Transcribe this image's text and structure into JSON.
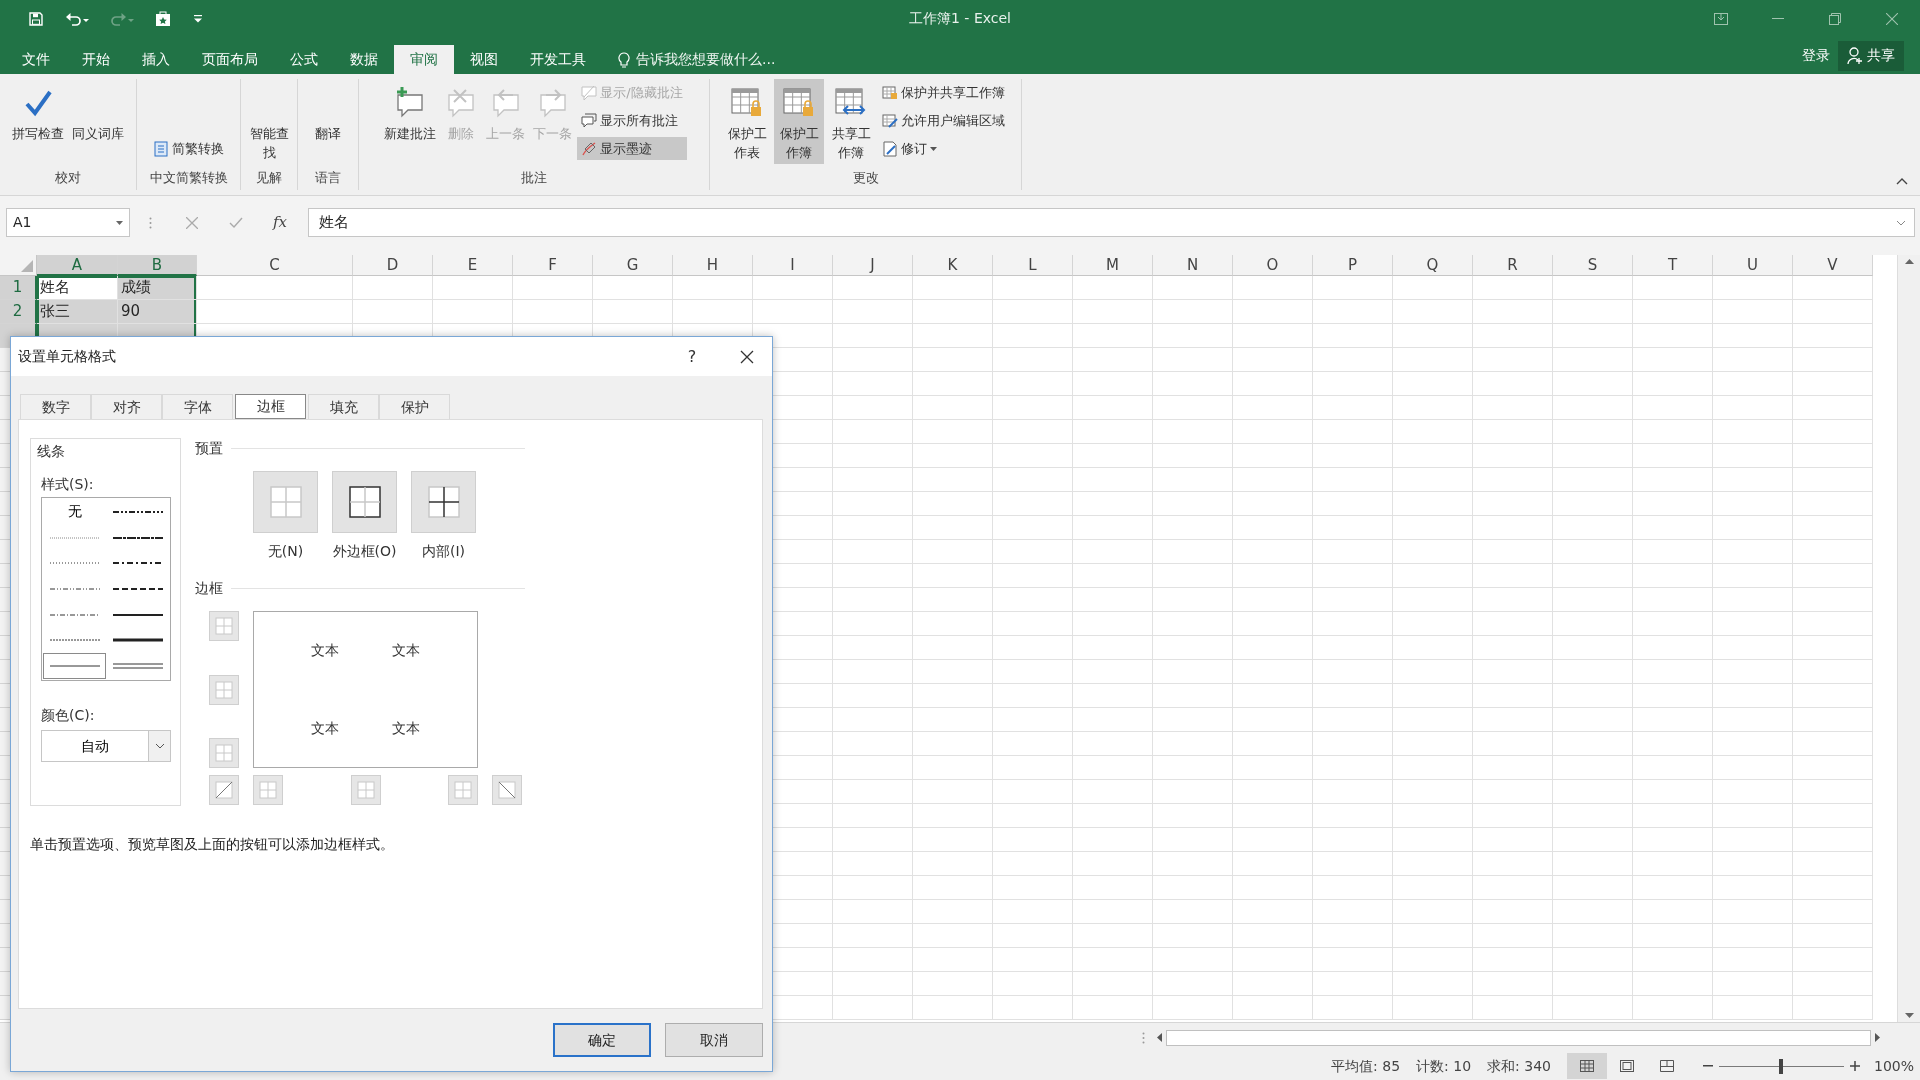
{
  "title_bar": {
    "title": "工作簿1 - Excel"
  },
  "quick_access": [
    {
      "kind": "save",
      "disabled": false
    },
    {
      "kind": "undo",
      "disabled": false
    },
    {
      "kind": "redo",
      "disabled": true
    },
    {
      "kind": "touch",
      "disabled": false
    },
    {
      "kind": "customize",
      "disabled": false
    }
  ],
  "menu_tabs": [
    {
      "label": "文件",
      "selected": false
    },
    {
      "label": "开始",
      "selected": false
    },
    {
      "label": "插入",
      "selected": false
    },
    {
      "label": "页面布局",
      "selected": false
    },
    {
      "label": "公式",
      "selected": false
    },
    {
      "label": "数据",
      "selected": false
    },
    {
      "label": "审阅",
      "selected": true
    },
    {
      "label": "视图",
      "selected": false
    },
    {
      "label": "开发工具",
      "selected": false
    }
  ],
  "tell_me": {
    "placeholder": "告诉我您想要做什么..."
  },
  "account": {
    "sign_in": "登录",
    "share": "共享"
  },
  "ribbon_groups": [
    {
      "label": "校对",
      "items": [
        {
          "kind": "large",
          "label": "拼写检查",
          "disabled": false,
          "selected": false,
          "dropdown": false
        },
        {
          "kind": "large",
          "label": "同义词库",
          "disabled": false,
          "selected": false,
          "dropdown": false
        }
      ]
    },
    {
      "label": "中文简繁转换",
      "items": [
        {
          "kind": "small",
          "label": "简繁转换",
          "disabled": false,
          "selected": false,
          "dropdown": false
        }
      ]
    },
    {
      "label": "见解",
      "items": [
        {
          "kind": "stacked",
          "label": "智能查找",
          "disabled": false,
          "selected": false,
          "dropdown": false
        }
      ]
    },
    {
      "label": "语言",
      "items": [
        {
          "kind": "large",
          "label": "翻译",
          "disabled": false,
          "selected": false,
          "dropdown": false
        }
      ]
    },
    {
      "label": "批注",
      "items": [
        {
          "kind": "large",
          "label": "新建批注",
          "disabled": false,
          "selected": false,
          "dropdown": false
        },
        {
          "kind": "large",
          "label": "删除",
          "disabled": true,
          "selected": false,
          "dropdown": false
        },
        {
          "kind": "large",
          "label": "上一条",
          "disabled": true,
          "selected": false,
          "dropdown": false
        },
        {
          "kind": "large",
          "label": "下一条",
          "disabled": true,
          "selected": false,
          "dropdown": false
        },
        {
          "kind": "small",
          "label": "显示/隐藏批注",
          "disabled": true,
          "selected": false,
          "dropdown": false
        },
        {
          "kind": "small",
          "label": "显示所有批注",
          "disabled": false,
          "selected": false,
          "dropdown": false
        },
        {
          "kind": "small",
          "label": "显示墨迹",
          "disabled": false,
          "selected": true,
          "dropdown": false
        }
      ]
    },
    {
      "label": "更改",
      "items": [
        {
          "kind": "stacked",
          "label": "保护工作表",
          "disabled": false,
          "selected": false,
          "dropdown": false
        },
        {
          "kind": "stacked",
          "label": "保护工作簿",
          "disabled": false,
          "selected": true,
          "dropdown": false
        },
        {
          "kind": "stacked",
          "label": "共享工作簿",
          "disabled": false,
          "selected": false,
          "dropdown": false
        },
        {
          "kind": "small",
          "label": "保护并共享工作簿",
          "disabled": false,
          "selected": false,
          "dropdown": false
        },
        {
          "kind": "small",
          "label": "允许用户编辑区域",
          "disabled": false,
          "selected": false,
          "dropdown": false
        },
        {
          "kind": "small",
          "label": "修订",
          "disabled": false,
          "selected": false,
          "dropdown": true
        }
      ]
    }
  ],
  "formula_bar": {
    "name_box": "A1",
    "fx": "fx",
    "formula": "姓名"
  },
  "sheet": {
    "columns": [
      {
        "label": "A",
        "selected": true
      },
      {
        "label": "B",
        "selected": true
      },
      {
        "label": "C",
        "selected": false
      },
      {
        "label": "D",
        "selected": false
      },
      {
        "label": "E",
        "selected": false
      },
      {
        "label": "F",
        "selected": false
      },
      {
        "label": "G",
        "selected": false
      },
      {
        "label": "H",
        "selected": false
      },
      {
        "label": "I",
        "selected": false
      },
      {
        "label": "J",
        "selected": false
      },
      {
        "label": "K",
        "selected": false
      },
      {
        "label": "L",
        "selected": false
      },
      {
        "label": "M",
        "selected": false
      },
      {
        "label": "N",
        "selected": false
      },
      {
        "label": "O",
        "selected": false
      },
      {
        "label": "P",
        "selected": false
      },
      {
        "label": "Q",
        "selected": false
      },
      {
        "label": "R",
        "selected": false
      },
      {
        "label": "S",
        "selected": false
      },
      {
        "label": "T",
        "selected": false
      },
      {
        "label": "U",
        "selected": false
      },
      {
        "label": "V",
        "selected": false
      }
    ],
    "rows": [
      {
        "header": "1",
        "selected": true,
        "cells": [
          {
            "text": "姓名",
            "selected": true,
            "active": true
          },
          {
            "text": "成绩",
            "selected": true,
            "active": false
          }
        ]
      },
      {
        "header": "2",
        "selected": true,
        "cells": [
          {
            "text": "张三",
            "selected": true,
            "active": false
          },
          {
            "text": "90",
            "selected": true,
            "active": false
          }
        ]
      },
      {
        "selected": true,
        "cells": [
          {
            "selected": true,
            "active": false
          },
          {
            "selected": true,
            "active": false
          }
        ]
      }
    ]
  },
  "dialog": {
    "title": "设置单元格格式",
    "help": "?",
    "tabs": [
      {
        "label": "数字",
        "selected": false
      },
      {
        "label": "对齐",
        "selected": false
      },
      {
        "label": "字体",
        "selected": false
      },
      {
        "label": "边框",
        "selected": true
      },
      {
        "label": "填充",
        "selected": false
      },
      {
        "label": "保护",
        "selected": false
      }
    ],
    "line_group": {
      "title": "线条",
      "style_label": "样式(S):",
      "styles": [
        {
          "kind": "none",
          "label": "无",
          "selected": false
        },
        {
          "kind": "hair",
          "selected": false
        },
        {
          "kind": "dotted",
          "selected": false
        },
        {
          "kind": "dash_dot_dot",
          "selected": false
        },
        {
          "kind": "dash_dot",
          "selected": false
        },
        {
          "kind": "dashed",
          "selected": false
        },
        {
          "kind": "thin",
          "selected": true
        },
        {
          "kind": "medium_dash_dot_dot",
          "selected": false
        },
        {
          "kind": "slant_dash_dot",
          "selected": false
        },
        {
          "kind": "medium_dash_dot",
          "selected": false
        },
        {
          "kind": "medium_dashed",
          "selected": false
        },
        {
          "kind": "medium",
          "selected": false
        },
        {
          "kind": "thick",
          "selected": false
        },
        {
          "kind": "double",
          "selected": false
        }
      ],
      "color_label": "颜色(C):",
      "color_value": "自动"
    },
    "presets": {
      "title": "预置",
      "items": [
        {
          "kind": "none",
          "label": "无(N)"
        },
        {
          "kind": "outline",
          "label": "外边框(O)"
        },
        {
          "kind": "inside",
          "label": "内部(I)"
        }
      ]
    },
    "border": {
      "title": "边框",
      "preview_texts": [
        "文本",
        "文本",
        "文本",
        "文本"
      ]
    },
    "hint": "单击预置选项、预览草图及上面的按钮可以添加边框样式。",
    "buttons": [
      {
        "label": "确定",
        "default": true
      },
      {
        "label": "取消",
        "default": false
      }
    ]
  },
  "status_bar": {
    "stats": [
      "平均值: 85",
      "计数: 10",
      "求和: 340"
    ],
    "views": [
      {
        "kind": "normal",
        "selected": true
      },
      {
        "kind": "page_layout",
        "selected": false
      },
      {
        "kind": "page_break",
        "selected": false
      }
    ],
    "zoom": {
      "level": 0.5,
      "reading": "100%"
    }
  }
}
